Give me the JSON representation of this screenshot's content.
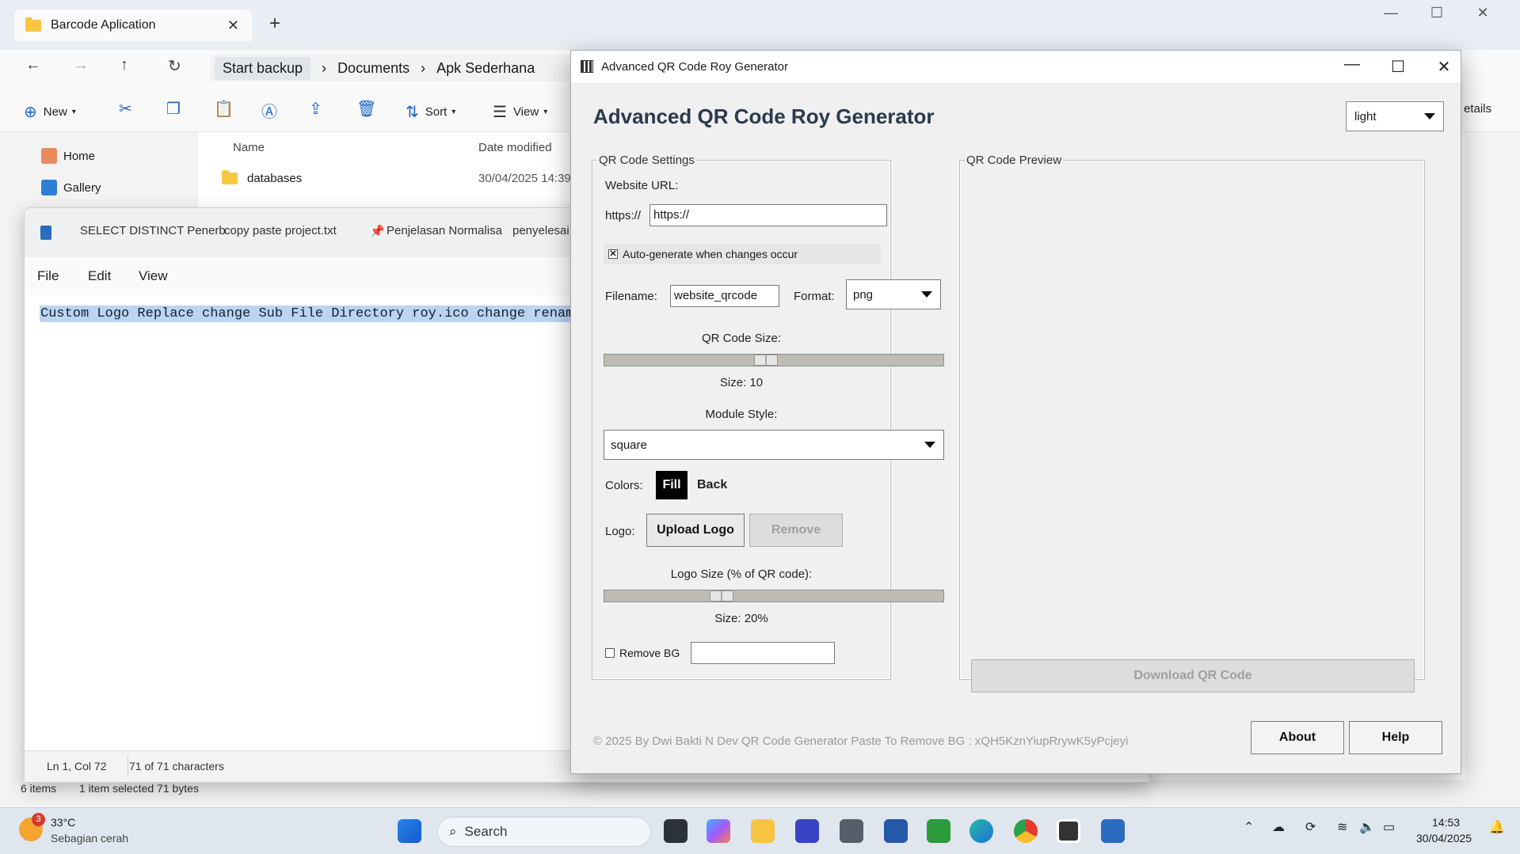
{
  "explorer": {
    "tab_title": "Barcode Aplication",
    "breadcrumbs": [
      "Start backup",
      "Documents",
      "Apk Sederhana"
    ],
    "toolbar": {
      "new": "New",
      "sort": "Sort",
      "view": "View",
      "details": "etails"
    },
    "sidebar": [
      {
        "label": "Home"
      },
      {
        "label": "Gallery"
      }
    ],
    "columns": {
      "name": "Name",
      "date": "Date modified"
    },
    "rows": [
      {
        "name": "databases",
        "date": "30/04/2025 14:39"
      }
    ],
    "status": {
      "items": "6 items",
      "selected": "1 item selected  71 bytes"
    }
  },
  "notepad": {
    "tabs": [
      "SELECT DISTINCT Penerb",
      "copy paste project.txt",
      "Penjelasan Normalisa",
      "penyelesai"
    ],
    "menu": {
      "file": "File",
      "edit": "Edit",
      "view": "View"
    },
    "content": "Custom Logo Replace change Sub File Directory roy.ico change rename",
    "status": {
      "pos": "Ln 1, Col 72",
      "chars": "71 of 71 characters"
    }
  },
  "qr": {
    "window_title": "Advanced QR Code Roy Generator",
    "heading": "Advanced QR Code Roy Generator",
    "theme": "light",
    "settings": {
      "legend": "QR Code Settings",
      "url_label": "Website URL:",
      "url_prefix": "https://",
      "url_value": "https://",
      "auto_label": "Auto-generate when changes occur",
      "auto_checked": "✕",
      "filename_label": "Filename:",
      "filename_value": "website_qrcode",
      "format_label": "Format:",
      "format_value": "png",
      "size_label": "QR Code Size:",
      "size_text": "Size: 10",
      "size_value": 10,
      "module_label": "Module Style:",
      "module_value": "square",
      "colors_label": "Colors:",
      "fill": "Fill",
      "back": "Back",
      "logo_label": "Logo:",
      "upload_logo": "Upload Logo",
      "remove": "Remove",
      "logo_size_label": "Logo Size (% of QR code):",
      "logo_size_text": "Size: 20%",
      "logo_size_value": 20,
      "remove_bg_label": "Remove BG"
    },
    "preview": {
      "legend": "QR Code Preview",
      "download": "Download QR Code"
    },
    "footer": "© 2025 By Dwi Bakti N Dev QR Code Generator  Paste To Remove BG : xQH5KznYiupRrywK5yPcjeyi",
    "about": "About",
    "help": "Help"
  },
  "taskbar": {
    "weather_temp": "33°C",
    "weather_desc": "Sebagian cerah",
    "weather_badge": "3",
    "search": "Search",
    "time": "14:53",
    "date": "30/04/2025"
  }
}
